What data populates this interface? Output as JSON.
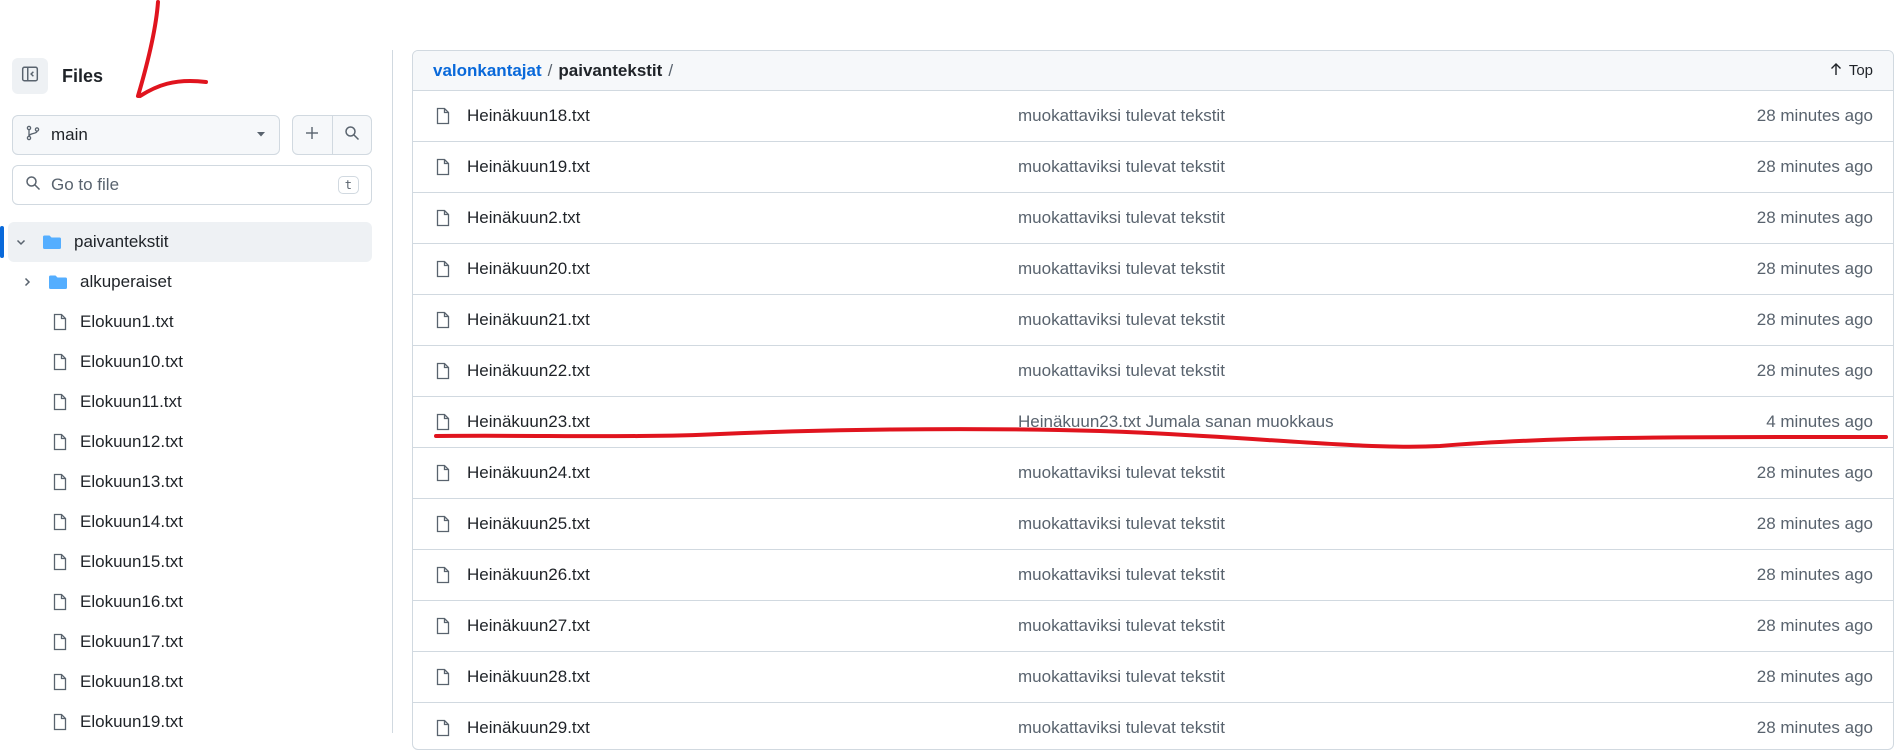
{
  "sidebar": {
    "title": "Files",
    "branch": {
      "label": "main"
    },
    "search": {
      "placeholder": "Go to file",
      "shortcut": "t"
    },
    "tree": [
      {
        "label": "paivantekstit",
        "type": "folder",
        "expanded": true,
        "selected": true
      },
      {
        "label": "alkuperaiset",
        "type": "folder",
        "expanded": false
      },
      {
        "label": "Elokuun1.txt",
        "type": "file"
      },
      {
        "label": "Elokuun10.txt",
        "type": "file"
      },
      {
        "label": "Elokuun11.txt",
        "type": "file"
      },
      {
        "label": "Elokuun12.txt",
        "type": "file"
      },
      {
        "label": "Elokuun13.txt",
        "type": "file"
      },
      {
        "label": "Elokuun14.txt",
        "type": "file"
      },
      {
        "label": "Elokuun15.txt",
        "type": "file"
      },
      {
        "label": "Elokuun16.txt",
        "type": "file"
      },
      {
        "label": "Elokuun17.txt",
        "type": "file"
      },
      {
        "label": "Elokuun18.txt",
        "type": "file"
      },
      {
        "label": "Elokuun19.txt",
        "type": "file"
      }
    ]
  },
  "breadcrumb": {
    "repo": "valonkantajat",
    "separator": "/",
    "current": "paivantekstit",
    "top_label": "Top"
  },
  "files": [
    {
      "name": "Heinäkuun18.txt",
      "message": "muokattaviksi tulevat tekstit",
      "age": "28 minutes ago"
    },
    {
      "name": "Heinäkuun19.txt",
      "message": "muokattaviksi tulevat tekstit",
      "age": "28 minutes ago"
    },
    {
      "name": "Heinäkuun2.txt",
      "message": "muokattaviksi tulevat tekstit",
      "age": "28 minutes ago"
    },
    {
      "name": "Heinäkuun20.txt",
      "message": "muokattaviksi tulevat tekstit",
      "age": "28 minutes ago"
    },
    {
      "name": "Heinäkuun21.txt",
      "message": "muokattaviksi tulevat tekstit",
      "age": "28 minutes ago"
    },
    {
      "name": "Heinäkuun22.txt",
      "message": "muokattaviksi tulevat tekstit",
      "age": "28 minutes ago"
    },
    {
      "name": "Heinäkuun23.txt",
      "message": "Heinäkuun23.txt Jumala sanan muokkaus",
      "age": "4 minutes ago"
    },
    {
      "name": "Heinäkuun24.txt",
      "message": "muokattaviksi tulevat tekstit",
      "age": "28 minutes ago"
    },
    {
      "name": "Heinäkuun25.txt",
      "message": "muokattaviksi tulevat tekstit",
      "age": "28 minutes ago"
    },
    {
      "name": "Heinäkuun26.txt",
      "message": "muokattaviksi tulevat tekstit",
      "age": "28 minutes ago"
    },
    {
      "name": "Heinäkuun27.txt",
      "message": "muokattaviksi tulevat tekstit",
      "age": "28 minutes ago"
    },
    {
      "name": "Heinäkuun28.txt",
      "message": "muokattaviksi tulevat tekstit",
      "age": "28 minutes ago"
    },
    {
      "name": "Heinäkuun29.txt",
      "message": "muokattaviksi tulevat tekstit",
      "age": "28 minutes ago"
    }
  ],
  "colors": {
    "accent": "#0969da",
    "annotation": "#e0141e",
    "folder": "#54aeff",
    "border": "#d1d9e0"
  },
  "icons": {
    "panel": "sidebar-collapse-icon",
    "branch": "git-branch-icon",
    "add": "plus-icon",
    "search": "search-icon",
    "folder": "folder-icon",
    "file": "file-icon",
    "arrow_up": "arrow-up-icon"
  }
}
